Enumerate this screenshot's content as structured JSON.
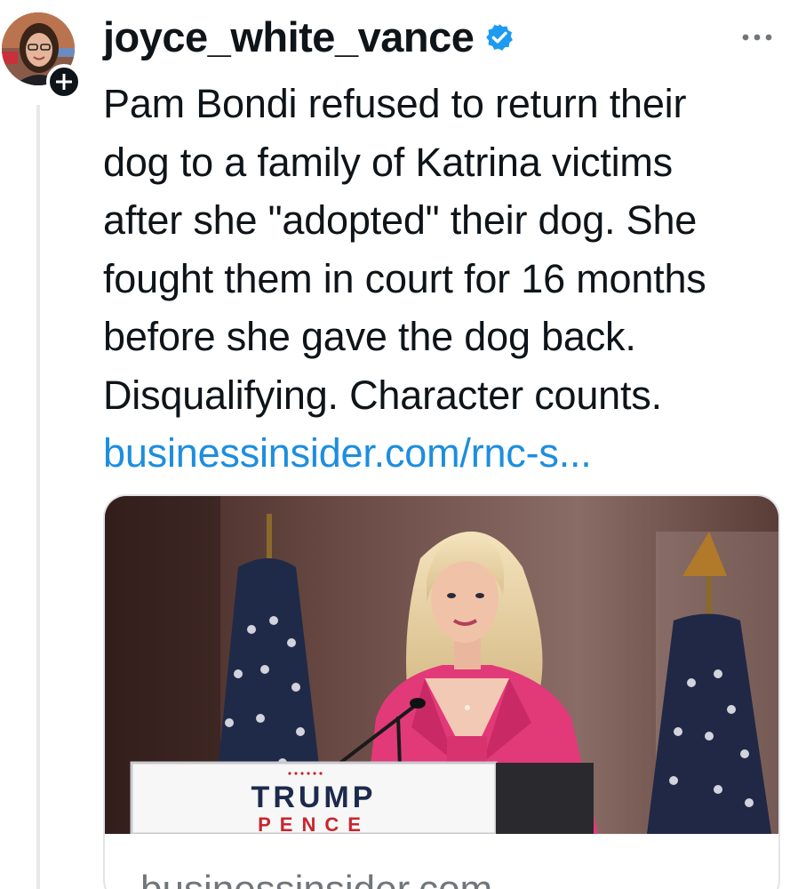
{
  "author": {
    "username": "joyce_white_vance",
    "verified": true,
    "avatar_icon": "profile-photo-icon",
    "follow_icon": "plus-icon"
  },
  "menu": {
    "icon": "more-horizontal-icon"
  },
  "post": {
    "text_lines": [
      "Pam Bondi refused to return their",
      "dog to a family of Katrina victims",
      "after she \"adopted\" their dog. She",
      "fought them in court for 16 months",
      "before she gave the dog back.",
      "Disqualifying. Character counts."
    ],
    "link_text": "businessinsider.com/rnc-s..."
  },
  "link_card": {
    "podium_top": "TRUMP",
    "podium_bottom": "PENCE",
    "domain": "businessinsider.com"
  },
  "colors": {
    "link": "#1d8ede",
    "verified": "#1d9bf0",
    "text": "#0f1419",
    "muted": "#71767b",
    "jacket": "#e23a78",
    "podium_navy": "#1c2a4c",
    "podium_red": "#c8252e"
  }
}
